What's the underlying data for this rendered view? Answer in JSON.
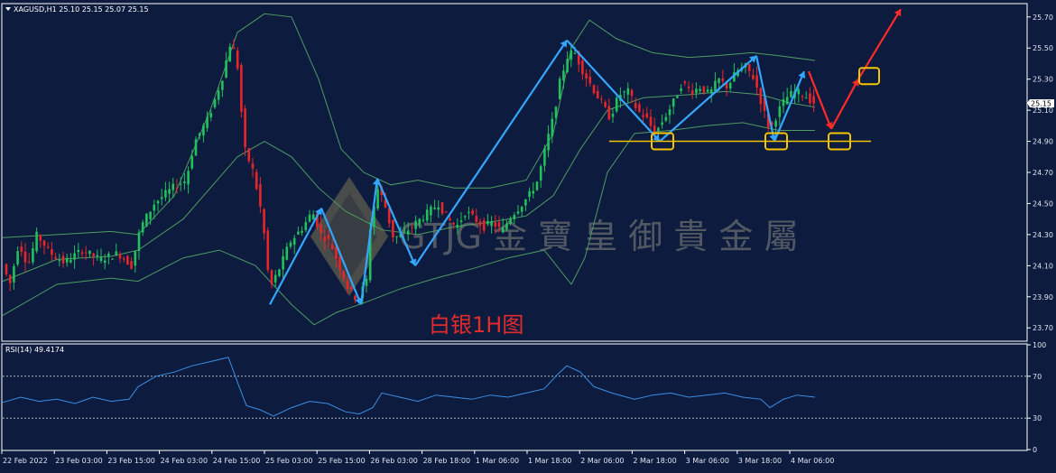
{
  "chart_data": [
    {
      "type": "candlestick",
      "symbol_header": "XAGUSD,H1  25.10 25.15 25.07 25.15",
      "last_price_tag": "25.15",
      "y_ticks": [
        "25.70",
        "25.50",
        "25.30",
        "25.10",
        "24.90",
        "24.70",
        "24.50",
        "24.30",
        "24.10",
        "23.90",
        "23.70"
      ],
      "ylim": [
        23.62,
        25.78
      ],
      "x_ticks": [
        "22 Feb 2022",
        "23 Feb 03:00",
        "23 Feb 15:00",
        "24 Feb 03:00",
        "24 Feb 15:00",
        "25 Feb 03:00",
        "25 Feb 15:00",
        "26 Feb 03:00",
        "28 Feb 18:00",
        "1 Mar 06:00",
        "1 Mar 18:00",
        "2 Mar 06:00",
        "2 Mar 18:00",
        "3 Mar 06:00",
        "3 Mar 18:00",
        "4 Mar 06:00"
      ],
      "price_path": [
        [
          0,
          24.14
        ],
        [
          10,
          23.98
        ],
        [
          20,
          24.25
        ],
        [
          30,
          24.1
        ],
        [
          40,
          24.3
        ],
        [
          55,
          24.18
        ],
        [
          70,
          24.12
        ],
        [
          90,
          24.2
        ],
        [
          110,
          24.14
        ],
        [
          130,
          24.18
        ],
        [
          145,
          24.1
        ],
        [
          155,
          24.35
        ],
        [
          170,
          24.5
        ],
        [
          190,
          24.6
        ],
        [
          205,
          24.65
        ],
        [
          215,
          24.9
        ],
        [
          230,
          25.05
        ],
        [
          245,
          25.3
        ],
        [
          255,
          25.55
        ],
        [
          262,
          25.4
        ],
        [
          270,
          24.85
        ],
        [
          280,
          24.7
        ],
        [
          290,
          24.4
        ],
        [
          298,
          23.95
        ],
        [
          310,
          24.1
        ],
        [
          320,
          24.25
        ],
        [
          335,
          24.35
        ],
        [
          345,
          24.45
        ],
        [
          355,
          24.3
        ],
        [
          365,
          24.25
        ],
        [
          375,
          24.1
        ],
        [
          385,
          23.95
        ],
        [
          395,
          23.88
        ],
        [
          405,
          24.0
        ],
        [
          410,
          24.4
        ],
        [
          418,
          24.6
        ],
        [
          425,
          24.5
        ],
        [
          435,
          24.28
        ],
        [
          445,
          24.3
        ],
        [
          455,
          24.35
        ],
        [
          465,
          24.4
        ],
        [
          475,
          24.45
        ],
        [
          485,
          24.5
        ],
        [
          495,
          24.4
        ],
        [
          505,
          24.35
        ],
        [
          515,
          24.45
        ],
        [
          525,
          24.4
        ],
        [
          535,
          24.35
        ],
        [
          545,
          24.38
        ],
        [
          555,
          24.32
        ],
        [
          565,
          24.42
        ],
        [
          575,
          24.48
        ],
        [
          585,
          24.55
        ],
        [
          595,
          24.65
        ],
        [
          605,
          24.9
        ],
        [
          612,
          25.05
        ],
        [
          620,
          25.3
        ],
        [
          628,
          25.45
        ],
        [
          635,
          25.48
        ],
        [
          645,
          25.35
        ],
        [
          655,
          25.25
        ],
        [
          665,
          25.15
        ],
        [
          675,
          25.05
        ],
        [
          685,
          25.2
        ],
        [
          695,
          25.22
        ],
        [
          705,
          25.1
        ],
        [
          715,
          25.05
        ],
        [
          725,
          24.95
        ],
        [
          735,
          25.05
        ],
        [
          745,
          25.15
        ],
        [
          755,
          25.28
        ],
        [
          765,
          25.22
        ],
        [
          775,
          25.25
        ],
        [
          785,
          25.2
        ],
        [
          795,
          25.3
        ],
        [
          805,
          25.25
        ],
        [
          815,
          25.35
        ],
        [
          825,
          25.38
        ],
        [
          835,
          25.3
        ],
        [
          845,
          25.1
        ],
        [
          852,
          24.97
        ],
        [
          862,
          25.1
        ],
        [
          870,
          25.18
        ],
        [
          880,
          25.22
        ],
        [
          890,
          25.2
        ],
        [
          900,
          25.15
        ]
      ],
      "bollinger": {
        "upper": [
          [
            0,
            24.28
          ],
          [
            60,
            24.3
          ],
          [
            120,
            24.32
          ],
          [
            150,
            24.3
          ],
          [
            190,
            24.55
          ],
          [
            230,
            25.1
          ],
          [
            260,
            25.6
          ],
          [
            290,
            25.72
          ],
          [
            320,
            25.7
          ],
          [
            350,
            25.3
          ],
          [
            375,
            24.85
          ],
          [
            400,
            24.7
          ],
          [
            430,
            24.62
          ],
          [
            460,
            24.65
          ],
          [
            500,
            24.6
          ],
          [
            540,
            24.6
          ],
          [
            580,
            24.65
          ],
          [
            610,
            24.95
          ],
          [
            630,
            25.5
          ],
          [
            650,
            25.68
          ],
          [
            680,
            25.56
          ],
          [
            720,
            25.47
          ],
          [
            760,
            25.44
          ],
          [
            790,
            25.45
          ],
          [
            830,
            25.47
          ],
          [
            860,
            25.45
          ],
          [
            900,
            25.42
          ]
        ],
        "middle": [
          [
            0,
            24.0
          ],
          [
            60,
            24.14
          ],
          [
            120,
            24.16
          ],
          [
            150,
            24.2
          ],
          [
            200,
            24.4
          ],
          [
            260,
            24.8
          ],
          [
            290,
            24.9
          ],
          [
            320,
            24.8
          ],
          [
            350,
            24.6
          ],
          [
            380,
            24.45
          ],
          [
            420,
            24.33
          ],
          [
            460,
            24.3
          ],
          [
            500,
            24.35
          ],
          [
            540,
            24.38
          ],
          [
            580,
            24.42
          ],
          [
            610,
            24.55
          ],
          [
            640,
            24.85
          ],
          [
            670,
            25.1
          ],
          [
            710,
            25.18
          ],
          [
            760,
            25.2
          ],
          [
            800,
            25.22
          ],
          [
            840,
            25.2
          ],
          [
            870,
            25.15
          ],
          [
            900,
            25.12
          ]
        ],
        "lower": [
          [
            0,
            23.78
          ],
          [
            60,
            23.98
          ],
          [
            120,
            24.02
          ],
          [
            150,
            24.0
          ],
          [
            200,
            24.15
          ],
          [
            240,
            24.2
          ],
          [
            280,
            24.1
          ],
          [
            320,
            23.85
          ],
          [
            345,
            23.72
          ],
          [
            370,
            23.8
          ],
          [
            400,
            23.86
          ],
          [
            440,
            23.95
          ],
          [
            480,
            24.02
          ],
          [
            520,
            24.08
          ],
          [
            560,
            24.15
          ],
          [
            600,
            24.2
          ],
          [
            630,
            23.98
          ],
          [
            645,
            24.15
          ],
          [
            670,
            24.7
          ],
          [
            700,
            24.95
          ],
          [
            740,
            24.97
          ],
          [
            780,
            25.0
          ],
          [
            820,
            25.02
          ],
          [
            860,
            24.97
          ],
          [
            900,
            24.97
          ]
        ]
      },
      "annotations": {
        "blue_zigzag": [
          [
            296,
            23.85
          ],
          [
            353,
            24.47
          ],
          [
            397,
            23.85
          ],
          [
            415,
            24.66
          ],
          [
            457,
            24.1
          ],
          [
            625,
            25.55
          ],
          [
            728,
            24.9
          ],
          [
            835,
            25.45
          ],
          [
            855,
            24.9
          ],
          [
            888,
            25.35
          ]
        ],
        "red_projection": [
          [
            893,
            25.35
          ],
          [
            918,
            24.98
          ],
          [
            948,
            25.3
          ],
          [
            995,
            25.75
          ]
        ],
        "support_line": {
          "price": 24.9,
          "x_start": 672,
          "x_end": 962
        },
        "support_boxes": [
          [
            731,
            24.9
          ],
          [
            857,
            24.9
          ],
          [
            927,
            24.9
          ]
        ],
        "target_box": [
          960,
          25.32
        ],
        "label": "白银1H图"
      },
      "watermark": "GTJG 金 寶 皇 御 貴 金 屬"
    },
    {
      "type": "line",
      "indicator_label": "RSI(14) 49.4174",
      "y_ticks": [
        "100",
        "70",
        "30",
        "0"
      ],
      "ylim": [
        0,
        100
      ],
      "levels": [
        70,
        30
      ],
      "rsi_path": [
        [
          0,
          45
        ],
        [
          20,
          50
        ],
        [
          40,
          46
        ],
        [
          60,
          48
        ],
        [
          80,
          44
        ],
        [
          100,
          50
        ],
        [
          120,
          46
        ],
        [
          140,
          48
        ],
        [
          150,
          60
        ],
        [
          170,
          70
        ],
        [
          190,
          74
        ],
        [
          210,
          80
        ],
        [
          230,
          84
        ],
        [
          250,
          88
        ],
        [
          262,
          60
        ],
        [
          270,
          42
        ],
        [
          285,
          38
        ],
        [
          300,
          32
        ],
        [
          320,
          40
        ],
        [
          340,
          46
        ],
        [
          360,
          44
        ],
        [
          380,
          36
        ],
        [
          395,
          34
        ],
        [
          410,
          40
        ],
        [
          420,
          54
        ],
        [
          440,
          50
        ],
        [
          460,
          46
        ],
        [
          480,
          52
        ],
        [
          500,
          50
        ],
        [
          520,
          48
        ],
        [
          540,
          52
        ],
        [
          560,
          50
        ],
        [
          580,
          54
        ],
        [
          600,
          58
        ],
        [
          615,
          72
        ],
        [
          625,
          80
        ],
        [
          640,
          74
        ],
        [
          655,
          60
        ],
        [
          675,
          54
        ],
        [
          700,
          48
        ],
        [
          720,
          52
        ],
        [
          740,
          54
        ],
        [
          760,
          50
        ],
        [
          780,
          52
        ],
        [
          800,
          54
        ],
        [
          820,
          50
        ],
        [
          840,
          48
        ],
        [
          850,
          40
        ],
        [
          865,
          48
        ],
        [
          880,
          52
        ],
        [
          900,
          50
        ]
      ],
      "color": "#3a8fe6"
    }
  ],
  "colors": {
    "background": "#0d1b3e",
    "bull": "#21c15b",
    "bear": "#e8262a",
    "bands": "#4f9b63",
    "zigzag": "#35a6ff",
    "projection": "#ff2a2a",
    "support": "#f5c400",
    "label": "#e22b2b",
    "axis_text": "#e0e4ef"
  }
}
